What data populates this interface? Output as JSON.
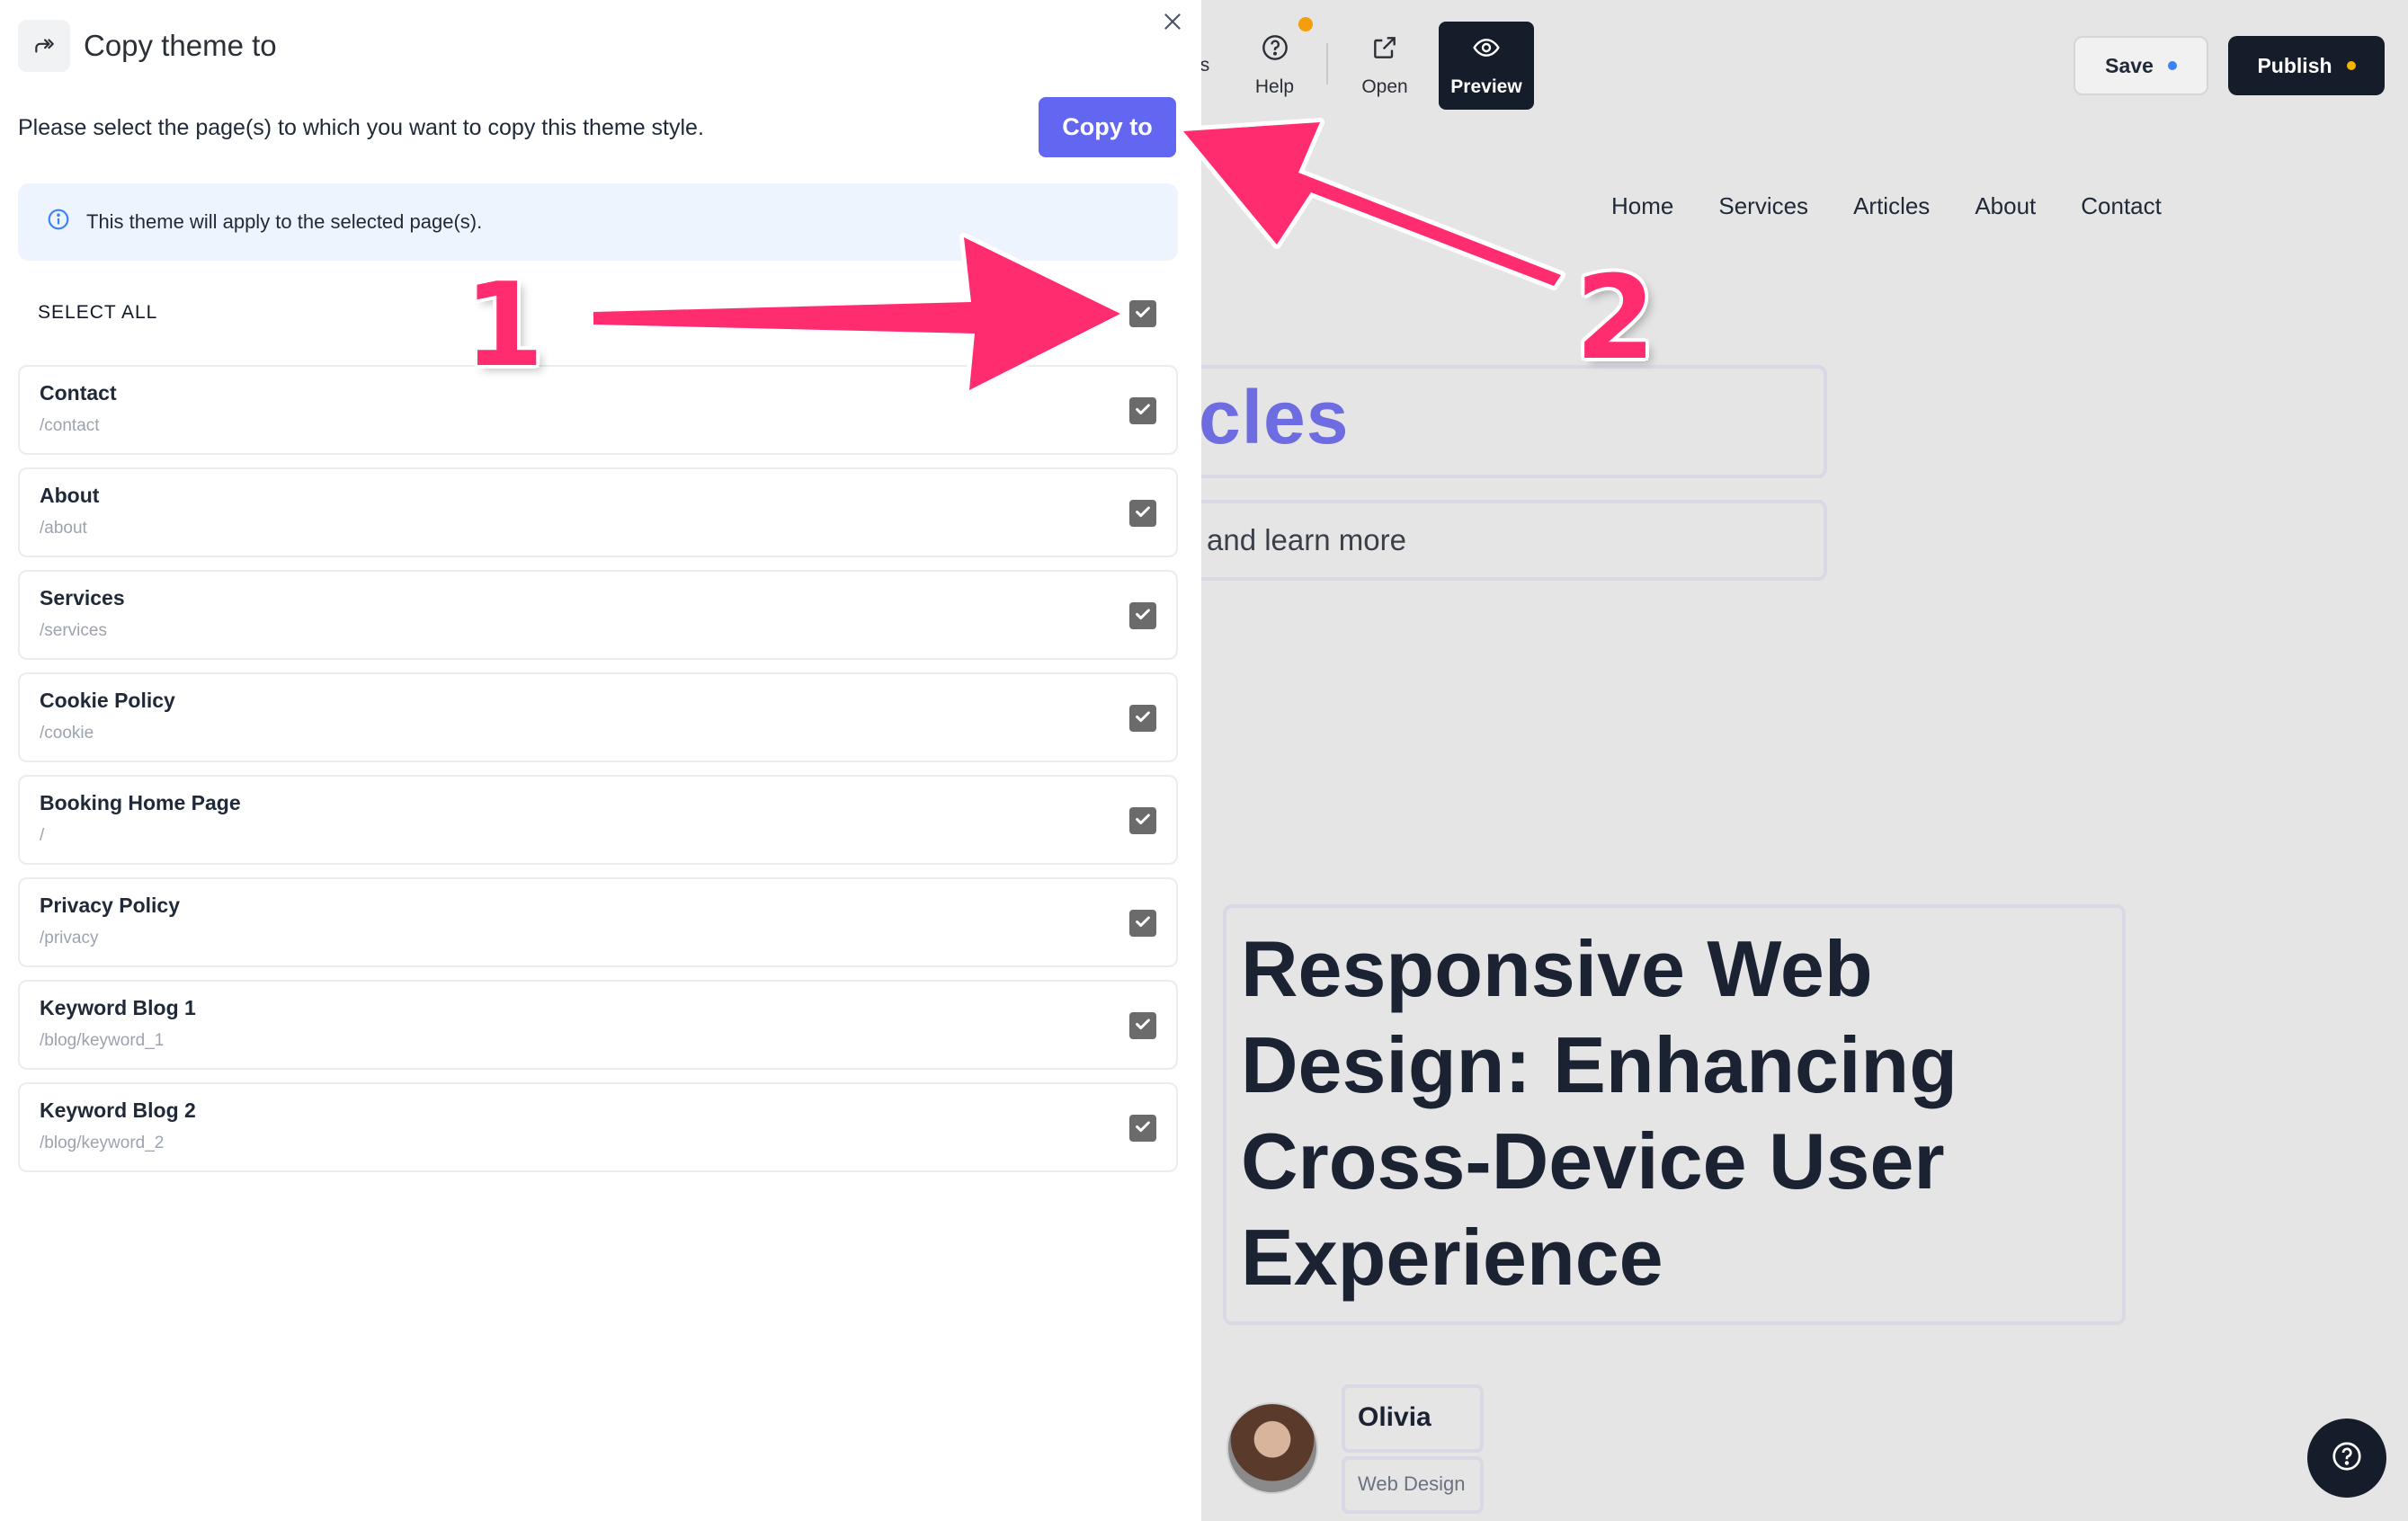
{
  "editor": {
    "toolbar": {
      "edge_label": "s",
      "help_label": "Help",
      "open_label": "Open",
      "preview_label": "Preview",
      "save_label": "Save",
      "publish_label": "Publish"
    },
    "site_nav": [
      "Home",
      "Services",
      "Articles",
      "About",
      "Contact"
    ],
    "heading_fragment": "cles",
    "subheading_fragment": "and learn more",
    "article_title": "Responsive Web Design: Enhancing Cross-Device User Experience",
    "author_name": "Olivia",
    "author_category": "Web Design"
  },
  "modal": {
    "title": "Copy theme to",
    "instructions": "Please select the page(s) to which you want to copy this theme style.",
    "copy_button": "Copy to",
    "info": "This theme will apply to the selected page(s).",
    "select_all_label": "SELECT ALL",
    "select_all_checked": true,
    "pages": [
      {
        "name": "Contact",
        "path": "/contact",
        "checked": true
      },
      {
        "name": "About",
        "path": "/about",
        "checked": true
      },
      {
        "name": "Services",
        "path": "/services",
        "checked": true
      },
      {
        "name": "Cookie Policy",
        "path": "/cookie",
        "checked": true
      },
      {
        "name": "Booking Home Page",
        "path": "/",
        "checked": true
      },
      {
        "name": "Privacy Policy",
        "path": "/privacy",
        "checked": true
      },
      {
        "name": "Keyword Blog 1",
        "path": "/blog/keyword_1",
        "checked": true
      },
      {
        "name": "Keyword Blog 2",
        "path": "/blog/keyword_2",
        "checked": true
      }
    ]
  },
  "annotations": {
    "step1": "1",
    "step2": "2",
    "color": "#ff2d6f"
  }
}
